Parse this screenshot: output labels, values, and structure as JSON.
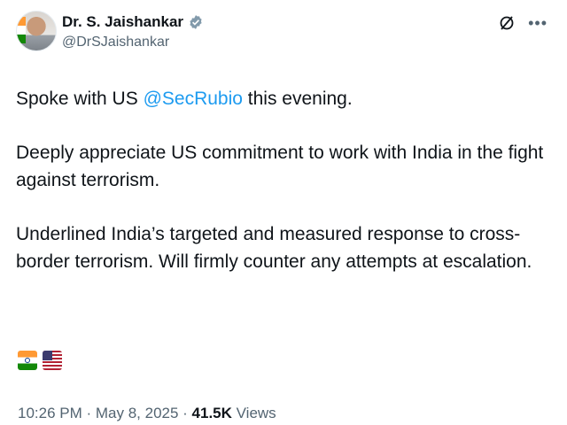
{
  "author": {
    "display_name": "Dr. S. Jaishankar",
    "handle": "@DrSJaishankar"
  },
  "post": {
    "line1_prefix": "Spoke with US ",
    "line1_mention": "@SecRubio",
    "line1_suffix": " this evening.",
    "paragraph2": "Deeply appreciate US commitment to work with India in the fight against terrorism.",
    "paragraph3": "Underlined India’s targeted and measured response to cross-border terrorism. Will firmly counter any attempts at escalation.",
    "emoji_flags": [
      "india-flag",
      "us-flag"
    ]
  },
  "meta": {
    "time": "10:26 PM",
    "separator": " · ",
    "date": "May 8, 2025",
    "views_count": "41.5K",
    "views_label": " Views"
  },
  "icons": {
    "verified": "verified-badge-icon",
    "grok": "grok-icon",
    "more": "more-icon"
  },
  "colors": {
    "mention": "#1d9bf0",
    "secondary_text": "#536471",
    "primary_text": "#0f1419"
  }
}
